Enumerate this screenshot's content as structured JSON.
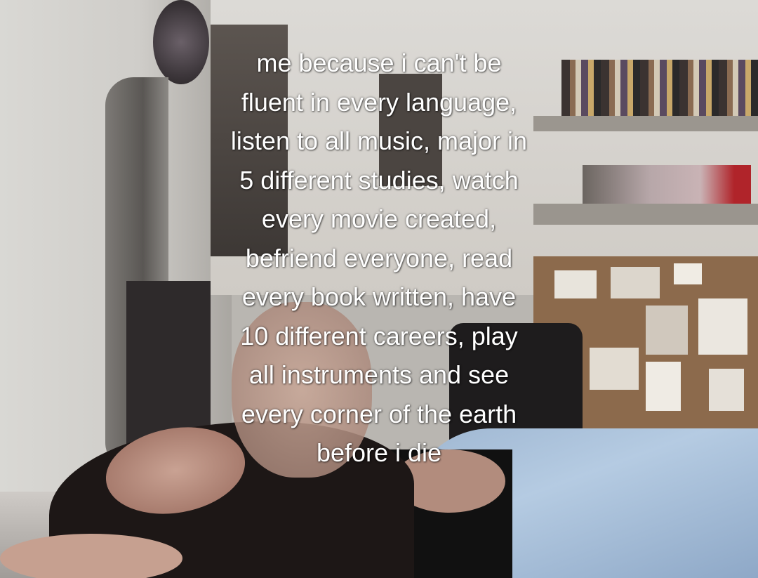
{
  "caption": {
    "lines": [
      "me because i can't be",
      "fluent in every language,",
      "listen to all music, major in",
      "5 different studies, watch",
      "every movie created,",
      "befriend everyone, read",
      "every book written, have",
      "10 different careers, play",
      "all instruments and see",
      "every corner of the earth",
      "before i die"
    ]
  }
}
